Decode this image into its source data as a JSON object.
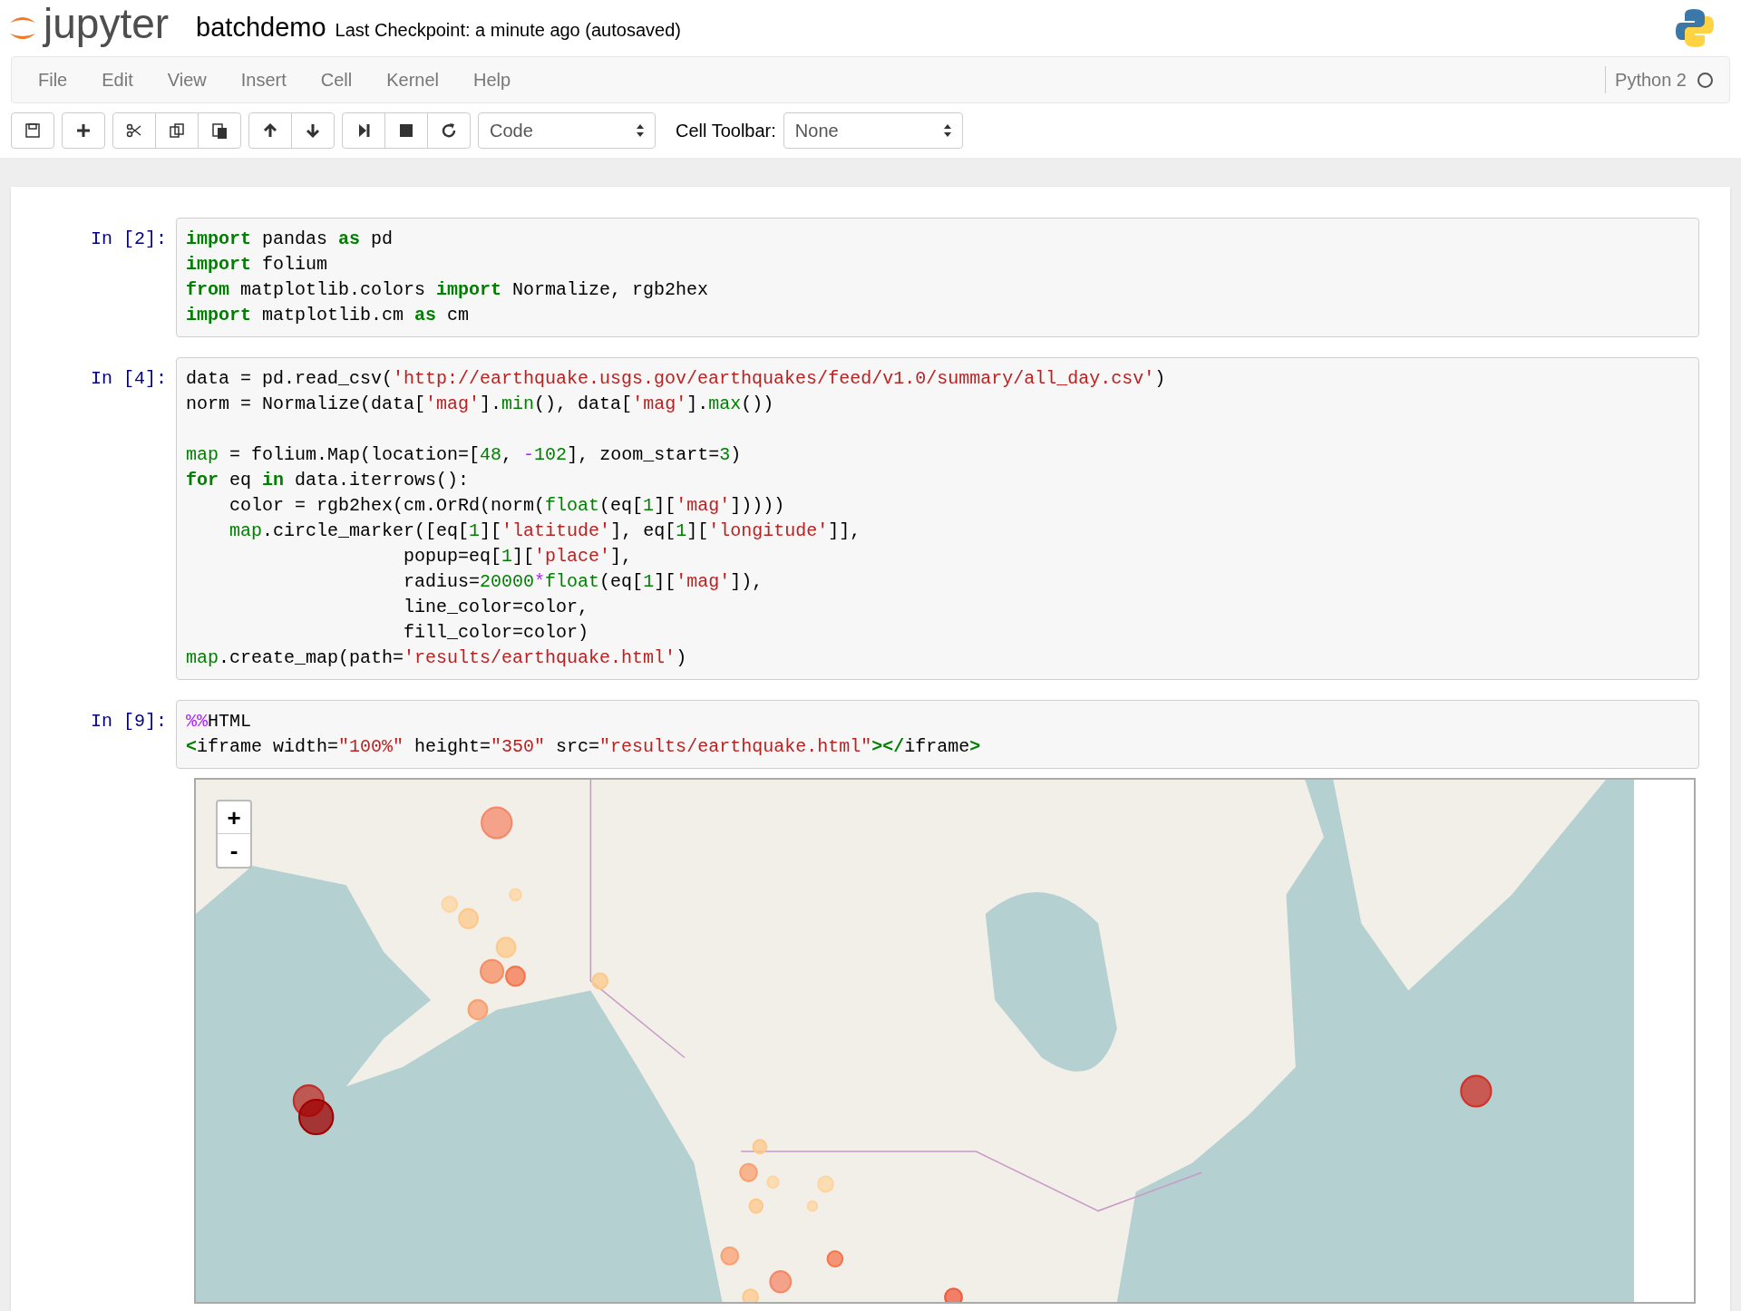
{
  "header": {
    "logo_text": "jupyter",
    "notebook_name": "batchdemo",
    "checkpoint": "Last Checkpoint: a minute ago (autosaved)"
  },
  "menu": [
    "File",
    "Edit",
    "View",
    "Insert",
    "Cell",
    "Kernel",
    "Help"
  ],
  "kernel": {
    "name": "Python 2",
    "busy": false
  },
  "toolbar": {
    "cell_type": "Code",
    "cell_toolbar_label": "Cell Toolbar:",
    "cell_toolbar_value": "None"
  },
  "cells": [
    {
      "prompt": "In [2]:",
      "lines": [
        [
          {
            "kind": "kw",
            "text": "import"
          },
          {
            "kind": "plain",
            "text": " pandas "
          },
          {
            "kind": "kw",
            "text": "as"
          },
          {
            "kind": "plain",
            "text": " pd"
          }
        ],
        [
          {
            "kind": "kw",
            "text": "import"
          },
          {
            "kind": "plain",
            "text": " folium"
          }
        ],
        [
          {
            "kind": "kw",
            "text": "from"
          },
          {
            "kind": "plain",
            "text": " matplotlib.colors "
          },
          {
            "kind": "kw",
            "text": "import"
          },
          {
            "kind": "plain",
            "text": " Normalize, rgb2hex"
          }
        ],
        [
          {
            "kind": "kw",
            "text": "import"
          },
          {
            "kind": "plain",
            "text": " matplotlib.cm "
          },
          {
            "kind": "kw",
            "text": "as"
          },
          {
            "kind": "plain",
            "text": " cm"
          }
        ]
      ]
    },
    {
      "prompt": "In [4]:",
      "lines": [
        [
          {
            "kind": "plain",
            "text": "data = pd.read_csv("
          },
          {
            "kind": "str",
            "text": "'http://earthquake.usgs.gov/earthquakes/feed/v1.0/summary/all_day.csv'"
          },
          {
            "kind": "plain",
            "text": ")"
          }
        ],
        [
          {
            "kind": "plain",
            "text": "norm = Normalize(data["
          },
          {
            "kind": "str",
            "text": "'mag'"
          },
          {
            "kind": "plain",
            "text": "]."
          },
          {
            "kind": "builtin",
            "text": "min"
          },
          {
            "kind": "plain",
            "text": "(), data["
          },
          {
            "kind": "str",
            "text": "'mag'"
          },
          {
            "kind": "plain",
            "text": "]."
          },
          {
            "kind": "builtin",
            "text": "max"
          },
          {
            "kind": "plain",
            "text": "())"
          }
        ],
        [
          {
            "kind": "gap"
          },
          {
            "kind": "builtin",
            "text": "map"
          },
          {
            "kind": "plain",
            "text": " = folium.Map(location=["
          },
          {
            "kind": "num",
            "text": "48"
          },
          {
            "kind": "plain",
            "text": ", "
          },
          {
            "kind": "op",
            "text": "-"
          },
          {
            "kind": "num",
            "text": "102"
          },
          {
            "kind": "plain",
            "text": "], zoom_start="
          },
          {
            "kind": "num",
            "text": "3"
          },
          {
            "kind": "plain",
            "text": ")"
          }
        ],
        [
          {
            "kind": "kw",
            "text": "for"
          },
          {
            "kind": "plain",
            "text": " eq "
          },
          {
            "kind": "kw",
            "text": "in"
          },
          {
            "kind": "plain",
            "text": " data.iterrows():"
          }
        ],
        [
          {
            "kind": "plain",
            "text": "    color = rgb2hex(cm.OrRd(norm("
          },
          {
            "kind": "builtin",
            "text": "float"
          },
          {
            "kind": "plain",
            "text": "(eq["
          },
          {
            "kind": "num",
            "text": "1"
          },
          {
            "kind": "plain",
            "text": "]["
          },
          {
            "kind": "str",
            "text": "'mag'"
          },
          {
            "kind": "plain",
            "text": "]))))"
          }
        ],
        [
          {
            "kind": "builtin",
            "text": "    map"
          },
          {
            "kind": "plain",
            "text": ".circle_marker([eq["
          },
          {
            "kind": "num",
            "text": "1"
          },
          {
            "kind": "plain",
            "text": "]["
          },
          {
            "kind": "str",
            "text": "'latitude'"
          },
          {
            "kind": "plain",
            "text": "], eq["
          },
          {
            "kind": "num",
            "text": "1"
          },
          {
            "kind": "plain",
            "text": "]["
          },
          {
            "kind": "str",
            "text": "'longitude'"
          },
          {
            "kind": "plain",
            "text": "]],"
          }
        ],
        [
          {
            "kind": "plain",
            "text": "                    popup=eq["
          },
          {
            "kind": "num",
            "text": "1"
          },
          {
            "kind": "plain",
            "text": "]["
          },
          {
            "kind": "str",
            "text": "'place'"
          },
          {
            "kind": "plain",
            "text": "],"
          }
        ],
        [
          {
            "kind": "plain",
            "text": "                    radius="
          },
          {
            "kind": "num",
            "text": "20000"
          },
          {
            "kind": "op",
            "text": "*"
          },
          {
            "kind": "builtin",
            "text": "float"
          },
          {
            "kind": "plain",
            "text": "(eq["
          },
          {
            "kind": "num",
            "text": "1"
          },
          {
            "kind": "plain",
            "text": "]["
          },
          {
            "kind": "str",
            "text": "'mag'"
          },
          {
            "kind": "plain",
            "text": "]),"
          }
        ],
        [
          {
            "kind": "plain",
            "text": "                    line_color=color,"
          }
        ],
        [
          {
            "kind": "plain",
            "text": "                    fill_color=color)"
          }
        ],
        [
          {
            "kind": "builtin",
            "text": "map"
          },
          {
            "kind": "plain",
            "text": ".create_map(path="
          },
          {
            "kind": "str",
            "text": "'results/earthquake.html'"
          },
          {
            "kind": "plain",
            "text": ")"
          }
        ]
      ]
    },
    {
      "prompt": "In [9]:",
      "lines": [
        [
          {
            "kind": "op",
            "text": "%%"
          },
          {
            "kind": "plain",
            "text": "HTML"
          }
        ],
        [
          {
            "kind": "kw",
            "text": "<"
          },
          {
            "kind": "plain",
            "text": "iframe width="
          },
          {
            "kind": "str",
            "text": "\"100%\""
          },
          {
            "kind": "plain",
            "text": " height="
          },
          {
            "kind": "str",
            "text": "\"350\""
          },
          {
            "kind": "plain",
            "text": " src="
          },
          {
            "kind": "str",
            "text": "\"results/earthquake.html\""
          },
          {
            "kind": "kw",
            "text": "></"
          },
          {
            "kind": "plain",
            "text": "iframe"
          },
          {
            "kind": "kw",
            "text": ">"
          }
        ]
      ],
      "output": {
        "zoom_in": "+",
        "zoom_out": "-"
      }
    }
  ]
}
